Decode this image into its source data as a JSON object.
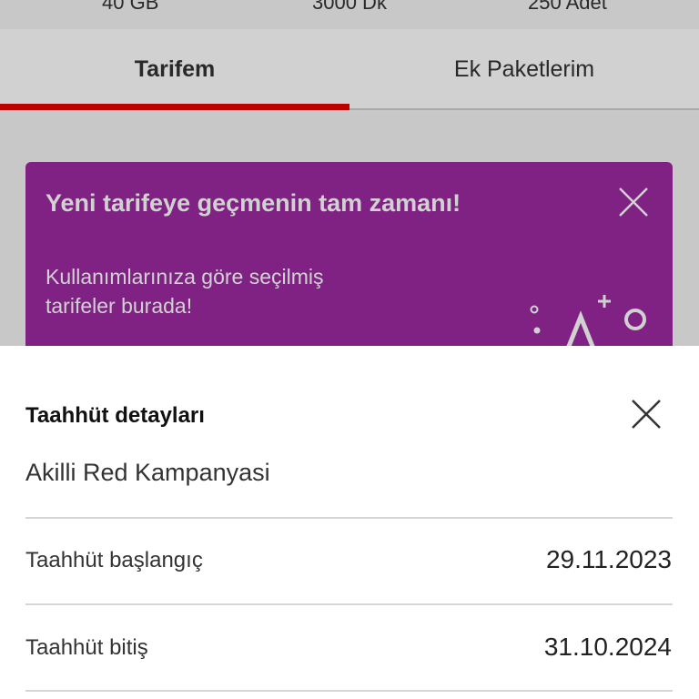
{
  "usage": {
    "data": "40 GB",
    "minutes": "3000 Dk",
    "sms": "250 Adet"
  },
  "tabs": [
    {
      "label": "Tarifem",
      "active": true
    },
    {
      "label": "Ek Paketlerim",
      "active": false
    }
  ],
  "promo": {
    "title": "Yeni tarifeye geçmenin tam zamanı!",
    "text": "Kullanımlarınıza göre seçilmiş tarifeler burada!"
  },
  "sheet": {
    "title": "Taahhüt detayları",
    "campaign": "Akilli Red Kampanyasi",
    "rows": [
      {
        "label": "Taahhüt başlangıç",
        "value": "29.11.2023"
      },
      {
        "label": "Taahhüt bitiş",
        "value": "31.10.2024"
      }
    ]
  },
  "colors": {
    "accent": "#e60000",
    "promo_bg": "#9c2aa0"
  }
}
